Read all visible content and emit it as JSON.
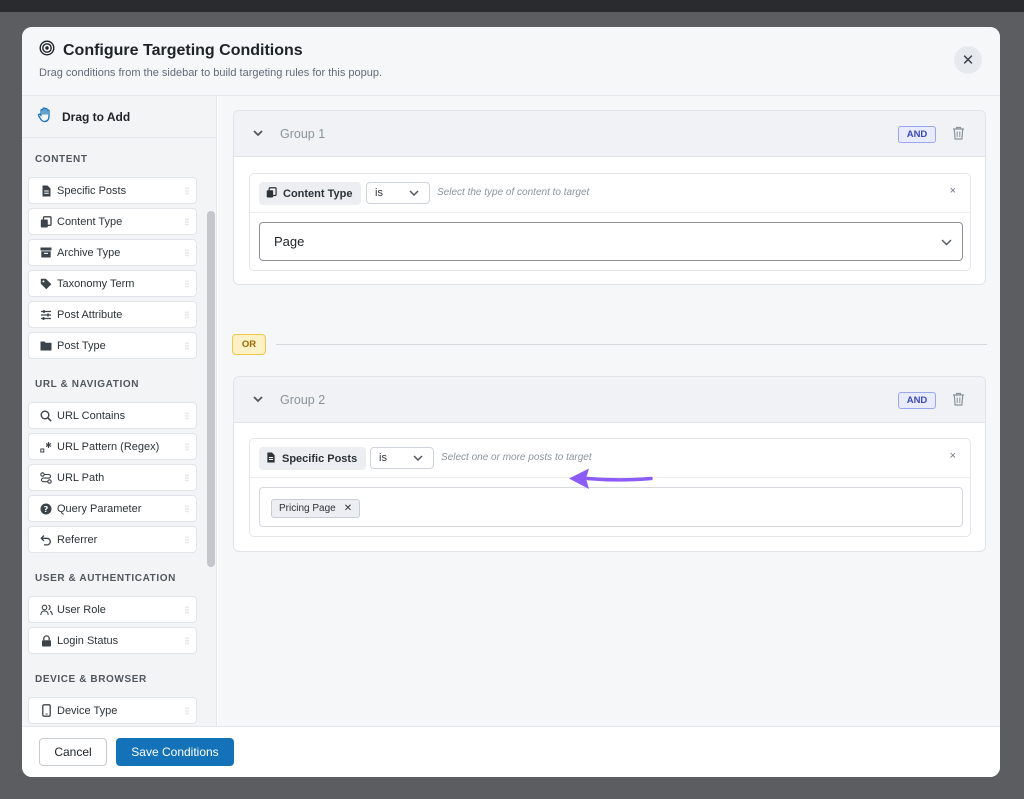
{
  "header": {
    "title": "Configure Targeting Conditions",
    "subtitle": "Drag conditions from the sidebar to build targeting rules for this popup.",
    "close_icon": "close-icon"
  },
  "sidebar": {
    "title": "Drag to Add",
    "sections": [
      {
        "label": "CONTENT",
        "items": [
          {
            "label": "Specific Posts",
            "icon": "document-icon"
          },
          {
            "label": "Content Type",
            "icon": "copy-icon"
          },
          {
            "label": "Archive Type",
            "icon": "archive-icon"
          },
          {
            "label": "Taxonomy Term",
            "icon": "tag-icon"
          },
          {
            "label": "Post Attribute",
            "icon": "sliders-icon"
          },
          {
            "label": "Post Type",
            "icon": "folder-icon"
          }
        ]
      },
      {
        "label": "URL & NAVIGATION",
        "items": [
          {
            "label": "URL Contains",
            "icon": "search-icon"
          },
          {
            "label": "URL Pattern (Regex)",
            "icon": "regex-icon"
          },
          {
            "label": "URL Path",
            "icon": "route-icon"
          },
          {
            "label": "Query Parameter",
            "icon": "question-icon"
          },
          {
            "label": "Referrer",
            "icon": "undo-icon"
          }
        ]
      },
      {
        "label": "USER & AUTHENTICATION",
        "items": [
          {
            "label": "User Role",
            "icon": "users-icon"
          },
          {
            "label": "Login Status",
            "icon": "lock-icon"
          }
        ]
      },
      {
        "label": "DEVICE & BROWSER",
        "items": [
          {
            "label": "Device Type",
            "icon": "mobile-icon"
          }
        ]
      }
    ]
  },
  "groups": [
    {
      "name": "Group 1",
      "logic": "AND",
      "condition": {
        "type": "Content Type",
        "operator": "is",
        "hint": "Select the type of content to target",
        "remove": "×",
        "value": "Page"
      }
    },
    {
      "name": "Group 2",
      "logic": "AND",
      "condition": {
        "type": "Specific Posts",
        "operator": "is",
        "hint": "Select one or more posts to target",
        "remove": "×",
        "tag": "Pricing Page",
        "tag_remove": "✕"
      }
    }
  ],
  "or_label": "OR",
  "footer": {
    "cancel": "Cancel",
    "save": "Save Conditions"
  },
  "colors": {
    "primary": "#1472b8",
    "and_badge": "#3c4bb5",
    "or_badge": "#f0c94a",
    "arrow": "#8b5cf6"
  }
}
